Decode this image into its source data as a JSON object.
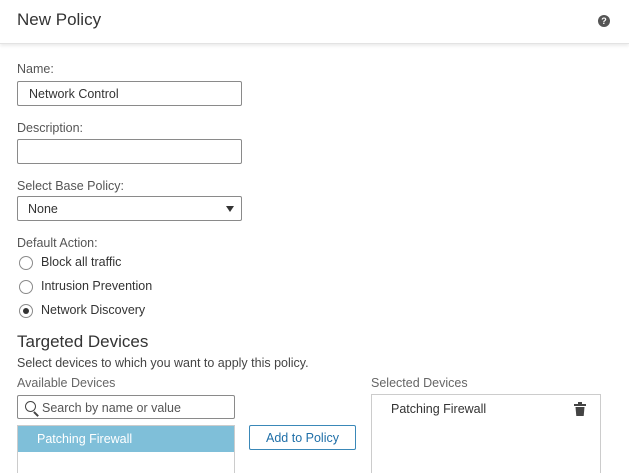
{
  "header": {
    "title": "New Policy",
    "help_icon": "help-icon",
    "help_glyph": "?"
  },
  "form": {
    "name_label": "Name:",
    "name_value": "Network Control",
    "description_label": "Description:",
    "description_value": "",
    "base_policy_label": "Select Base Policy:",
    "base_policy_value": "None",
    "default_action_label": "Default Action:",
    "default_actions": [
      {
        "label": "Block all traffic",
        "checked": false
      },
      {
        "label": "Intrusion Prevention",
        "checked": false
      },
      {
        "label": "Network Discovery",
        "checked": true
      }
    ]
  },
  "targeted": {
    "title": "Targeted Devices",
    "description": "Select devices to which you want to apply this policy.",
    "available_label": "Available Devices",
    "search_placeholder": "Search by name or value",
    "available_items": [
      "Patching Firewall"
    ],
    "add_button_label": "Add to Policy",
    "selected_label": "Selected Devices",
    "selected_items": [
      "Patching Firewall"
    ]
  },
  "colors": {
    "accent": "#1f6fa8",
    "selected_row": "#7fbfd9",
    "border": "#8a8a8a"
  }
}
